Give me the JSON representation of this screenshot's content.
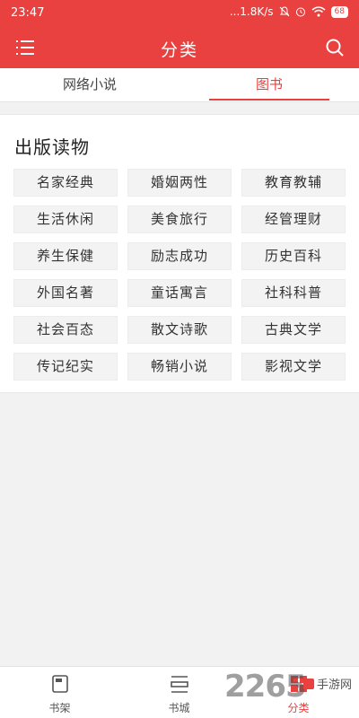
{
  "status_bar": {
    "time": "23:47",
    "net_speed": "...1.8K/s",
    "battery": "68"
  },
  "app_bar": {
    "title": "分类",
    "menu_icon": "menu-icon",
    "search_icon": "search-icon"
  },
  "tabs": [
    {
      "label": "网络小说",
      "active": false
    },
    {
      "label": "图书",
      "active": true
    }
  ],
  "section": {
    "title": "出版读物",
    "categories": [
      "名家经典",
      "婚姻两性",
      "教育教辅",
      "生活休闲",
      "美食旅行",
      "经管理财",
      "养生保健",
      "励志成功",
      "历史百科",
      "外国名著",
      "童话寓言",
      "社科科普",
      "社会百态",
      "散文诗歌",
      "古典文学",
      "传记纪实",
      "畅销小说",
      "影视文学"
    ]
  },
  "bottom_nav": [
    {
      "label": "书架",
      "icon": "bookshelf-icon",
      "active": false
    },
    {
      "label": "书城",
      "icon": "bookstore-icon",
      "active": false
    },
    {
      "label": "分类",
      "icon": "category-icon",
      "active": true
    }
  ],
  "watermark": {
    "number": "2265",
    "text": "手游网"
  },
  "colors": {
    "accent": "#e8413f"
  }
}
